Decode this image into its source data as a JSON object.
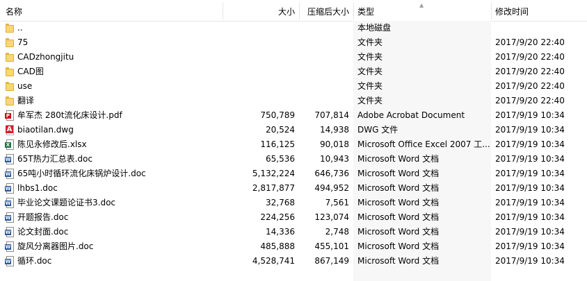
{
  "columns": {
    "name": "名称",
    "size": "大小",
    "compressed": "压缩后大小",
    "type": "类型",
    "modified": "修改时间"
  },
  "files": [
    {
      "name": "..",
      "size": "",
      "compressed": "",
      "type": "本地磁盘",
      "modified": "",
      "icon": "folder-icon"
    },
    {
      "name": "75",
      "size": "",
      "compressed": "",
      "type": "文件夹",
      "modified": "2017/9/20 22:40",
      "icon": "folder-icon"
    },
    {
      "name": "CADzhongjitu",
      "size": "",
      "compressed": "",
      "type": "文件夹",
      "modified": "2017/9/20 22:40",
      "icon": "folder-icon"
    },
    {
      "name": "CAD图",
      "size": "",
      "compressed": "",
      "type": "文件夹",
      "modified": "2017/9/20 22:40",
      "icon": "folder-icon"
    },
    {
      "name": "use",
      "size": "",
      "compressed": "",
      "type": "文件夹",
      "modified": "2017/9/20 22:40",
      "icon": "folder-icon"
    },
    {
      "name": "翻译",
      "size": "",
      "compressed": "",
      "type": "文件夹",
      "modified": "2017/9/20 22:40",
      "icon": "folder-icon"
    },
    {
      "name": "牟军杰  280t流化床设计.pdf",
      "size": "750,789",
      "compressed": "707,814",
      "type": "Adobe Acrobat Document",
      "modified": "2017/9/19 10:34",
      "icon": "pdf-file-icon"
    },
    {
      "name": "biaotilan.dwg",
      "size": "20,524",
      "compressed": "14,938",
      "type": "DWG 文件",
      "modified": "2017/9/19 10:34",
      "icon": "dwg-file-icon"
    },
    {
      "name": "陈见永修改后.xlsx",
      "size": "116,125",
      "compressed": "90,018",
      "type": "Microsoft Office Excel 2007 工...",
      "modified": "2017/9/19 10:34",
      "icon": "excel-file-icon"
    },
    {
      "name": "65T热力汇总表.doc",
      "size": "65,536",
      "compressed": "10,943",
      "type": "Microsoft Word 文档",
      "modified": "2017/9/19 10:34",
      "icon": "word-file-icon"
    },
    {
      "name": "65吨小时循环流化床锅炉设计.doc",
      "size": "5,132,224",
      "compressed": "646,736",
      "type": "Microsoft Word 文档",
      "modified": "2017/9/19 10:34",
      "icon": "word-file-icon"
    },
    {
      "name": "lhbs1.doc",
      "size": "2,817,877",
      "compressed": "494,952",
      "type": "Microsoft Word 文档",
      "modified": "2017/9/19 10:34",
      "icon": "word-file-icon"
    },
    {
      "name": "毕业论文课题论证书3.doc",
      "size": "32,768",
      "compressed": "7,561",
      "type": "Microsoft Word 文档",
      "modified": "2017/9/19 10:34",
      "icon": "word-file-icon"
    },
    {
      "name": "开题报告.doc",
      "size": "224,256",
      "compressed": "123,074",
      "type": "Microsoft Word 文档",
      "modified": "2017/9/19 10:34",
      "icon": "word-file-icon"
    },
    {
      "name": "论文封面.doc",
      "size": "14,336",
      "compressed": "2,748",
      "type": "Microsoft Word 文档",
      "modified": "2017/9/19 10:34",
      "icon": "word-file-icon"
    },
    {
      "name": "旋风分离器图片.doc",
      "size": "485,888",
      "compressed": "455,101",
      "type": "Microsoft Word 文档",
      "modified": "2017/9/19 10:34",
      "icon": "word-file-icon"
    },
    {
      "name": "循环.doc",
      "size": "4,528,741",
      "compressed": "867,149",
      "type": "Microsoft Word 文档",
      "modified": "2017/9/19 10:34",
      "icon": "word-file-icon"
    }
  ]
}
